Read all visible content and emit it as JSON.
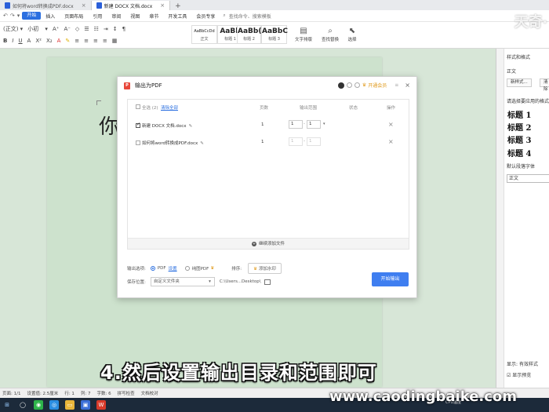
{
  "tabs": [
    {
      "label": "如何将word转换成PDF.docx",
      "active": false
    },
    {
      "label": "新建 DOCX 文档.docx",
      "active": true
    }
  ],
  "menu": {
    "start": "开始",
    "items": [
      "插入",
      "页面布局",
      "引用",
      "审阅",
      "视图",
      "章节",
      "开发工具",
      "会员专享"
    ],
    "search": "查找命令、搜索模板"
  },
  "ribbon": {
    "font_size": "小初",
    "styles": [
      {
        "preview": "AaBbCcDd",
        "name": "正文"
      },
      {
        "preview": "AaBb",
        "name": "标题 1"
      },
      {
        "preview": "AaBb(",
        "name": "标题 2"
      },
      {
        "preview": "AaBbC",
        "name": "标题 3"
      }
    ],
    "tools": [
      "文字排版",
      "查找替换",
      "选择"
    ]
  },
  "watermark_top": "天奇·",
  "page": {
    "char": "你"
  },
  "right_panel": {
    "title": "样式和格式",
    "current": "正文",
    "new_style": "新样式...",
    "clear": "清除",
    "prompt": "请选择要应用的格式",
    "headings": [
      "标题 1",
      "标题 2",
      "标题 3",
      "标题 4"
    ],
    "default_font": "默认段落字体",
    "field": "正文",
    "show_label": "显示:",
    "show_value": "有效样式",
    "preview_label": "显示预览"
  },
  "dialog": {
    "title": "输出为PDF",
    "vip": "开通会员",
    "header": {
      "select_all": "全选 (2)",
      "clear_all": "清除全部",
      "pages": "页数",
      "range": "输出范围",
      "status": "状态",
      "ops": "操作"
    },
    "rows": [
      {
        "name": "新建 DOCX 文档.docx",
        "pages": "1",
        "from": "1",
        "to": "1",
        "checked": true
      },
      {
        "name": "如何将word转换成PDF.docx",
        "pages": "1",
        "from": "1",
        "to": "1",
        "checked": false
      }
    ],
    "add_more": "继续添加文件",
    "output_label": "输出选项:",
    "opt_pdf": "PDF",
    "settings": "设置",
    "opt_image": "纯图PDF",
    "sort_label": "排序:",
    "watermark_btn": "添加水印",
    "save_label": "保存位置:",
    "save_select": "自定义文件夹",
    "save_path": "C:\\Users...Desktop\\",
    "start_button": "开始输出"
  },
  "status": {
    "page": "页面: 1/1",
    "position": "设置值: 2.5厘米",
    "line": "行: 1",
    "col": "列: 7",
    "words": "字数: 6",
    "spell": "拼写检查",
    "proof": "文档校对"
  },
  "subtitle": "4.然后设置输出目录和范围即可",
  "site_mark": "www.caodingbaike.com",
  "cpu": "CPU温度"
}
